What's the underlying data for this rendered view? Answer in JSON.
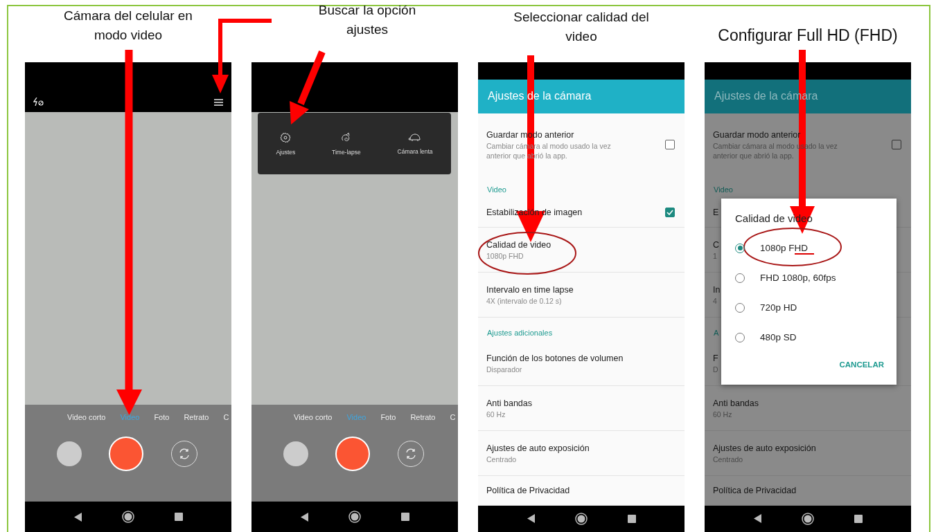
{
  "panels": [
    {
      "kind": "camera",
      "caption": "Cámara del celular en modo video",
      "top_icons": true,
      "modes": [
        {
          "label": "Video corto",
          "selected": false
        },
        {
          "label": "Video",
          "selected": true
        },
        {
          "label": "Foto",
          "selected": false
        },
        {
          "label": "Retrato",
          "selected": false
        },
        {
          "label": "C",
          "selected": false
        }
      ]
    },
    {
      "kind": "camera",
      "caption": "Buscar la opción ajustes",
      "top_icons": false,
      "menu": [
        {
          "label": "Ajustes"
        },
        {
          "label": "Time-lapse"
        },
        {
          "label": "Cámara lenta"
        }
      ],
      "modes": [
        {
          "label": "Video corto",
          "selected": false
        },
        {
          "label": "Video",
          "selected": true
        },
        {
          "label": "Foto",
          "selected": false
        },
        {
          "label": "Retrato",
          "selected": false
        },
        {
          "label": "C",
          "selected": false
        }
      ]
    },
    {
      "kind": "settings",
      "caption": "Seleccionar calidad del video",
      "title": "Ajustes de la cámara",
      "dimmed": false,
      "items": [
        {
          "kind": "check",
          "title": "Guardar modo anterior",
          "subtitle": "Cambiar cámara al modo usado la vez anterior que abrió la app.",
          "checked": false
        },
        {
          "kind": "section",
          "title": "Video"
        },
        {
          "kind": "check",
          "title": "Estabilización de imagen",
          "checked": true
        },
        {
          "kind": "item",
          "title": "Calidad de video",
          "subtitle": "1080p FHD"
        },
        {
          "kind": "item",
          "title": "Intervalo en time lapse",
          "subtitle": "4X (intervalo de 0.12 s)"
        },
        {
          "kind": "section",
          "title": "Ajustes adicionales"
        },
        {
          "kind": "item",
          "title": "Función de los botones de volumen",
          "subtitle": "Disparador"
        },
        {
          "kind": "item",
          "title": "Anti bandas",
          "subtitle": "60 Hz"
        },
        {
          "kind": "item",
          "title": "Ajustes de auto exposición",
          "subtitle": "Centrado"
        },
        {
          "kind": "item",
          "title": "Política de Privacidad"
        }
      ]
    },
    {
      "kind": "settings",
      "caption": "Configurar Full HD (FHD)",
      "title": "Ajustes de la cámara",
      "dimmed": true,
      "items": [
        {
          "kind": "check",
          "title": "Guardar modo anterior",
          "subtitle": "Cambiar cámara al modo usado la vez anterior que abrió la app.",
          "checked": false
        },
        {
          "kind": "section",
          "title": "Video"
        },
        {
          "kind": "item",
          "title": "E"
        },
        {
          "kind": "item",
          "title": "C",
          "subtitle": "1"
        },
        {
          "kind": "item",
          "title": "In",
          "subtitle": "4"
        },
        {
          "kind": "section",
          "title": "A"
        },
        {
          "kind": "item",
          "title": "F",
          "subtitle": "D"
        },
        {
          "kind": "item",
          "title": "Anti bandas",
          "subtitle": "60 Hz"
        },
        {
          "kind": "item",
          "title": "Ajustes de auto exposición",
          "subtitle": "Centrado"
        },
        {
          "kind": "item",
          "title": "Política de Privacidad"
        }
      ],
      "dialog": {
        "title": "Calidad de video",
        "options": [
          {
            "label": "1080p FHD",
            "selected": true
          },
          {
            "label": "FHD 1080p, 60fps",
            "selected": false
          },
          {
            "label": "720p HD",
            "selected": false
          },
          {
            "label": "480p SD",
            "selected": false
          }
        ],
        "button": "CANCELAR"
      }
    }
  ]
}
